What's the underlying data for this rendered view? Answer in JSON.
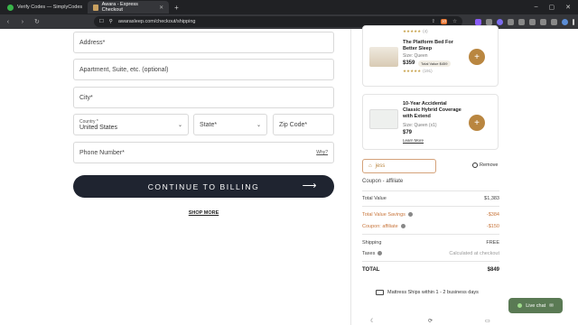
{
  "browser": {
    "tabs": [
      {
        "label": "Verify Codes — SimplyCodes",
        "active": false
      },
      {
        "label": "Awara - Express Checkout",
        "active": true
      }
    ],
    "new_tab": "+",
    "url": "awarasleep.com/checkout/shipping",
    "ext_badge": "10"
  },
  "form": {
    "address": "Address*",
    "apartment": "Apartment, Suite, etc. (optional)",
    "city": "City*",
    "country_label": "Country *",
    "country_value": "United States",
    "state": "State*",
    "zip": "Zip Code*",
    "phone": "Phone Number*",
    "why": "Why?",
    "continue": "CONTINUE TO BILLING",
    "shop_more": "SHOP MORE"
  },
  "products": [
    {
      "name": "The Platform Bed For Better Sleep",
      "size": "Size: Queen",
      "price": "$359",
      "badge": "Total Value $459",
      "reviews": "(191)"
    },
    {
      "name": "10-Year Accidental Classic Hybrid Coverage with Extend",
      "size": "Size: Queen (x1)",
      "price": "$79",
      "link": "Learn More"
    }
  ],
  "coupon": {
    "code": "jess",
    "remove": "Remove",
    "label": "Coupon - affiliate"
  },
  "summary": {
    "total_value_label": "Total Value",
    "total_value": "$1,383",
    "savings_label": "Total Value Savings",
    "savings": "-$384",
    "coupon_label": "Coupon: affiliate",
    "coupon": "-$150",
    "shipping_label": "Shipping",
    "shipping": "FREE",
    "taxes_label": "Taxes",
    "taxes": "Calculated at checkout",
    "total_label": "TOTAL",
    "total": "$849"
  },
  "ship_note": "Mattress Ships within 1 - 2 business days",
  "live_chat": "Live chat",
  "colors": {
    "accent": "#b98640",
    "cta": "#1f2430",
    "chat": "#5a7a54"
  }
}
